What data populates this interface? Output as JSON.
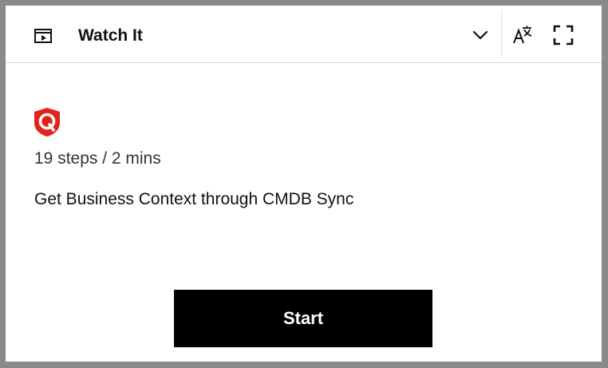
{
  "header": {
    "title": "Watch It",
    "icon": "video-play-icon",
    "chevron_icon": "chevron-down-icon",
    "translate_icon": "translate-icon",
    "fullscreen_icon": "fullscreen-icon"
  },
  "guide": {
    "logo": "qualys-logo",
    "logo_color": "#e2231a",
    "meta": "19 steps / 2 mins",
    "title": "Get Business Context through CMDB Sync"
  },
  "actions": {
    "start_label": "Start"
  }
}
